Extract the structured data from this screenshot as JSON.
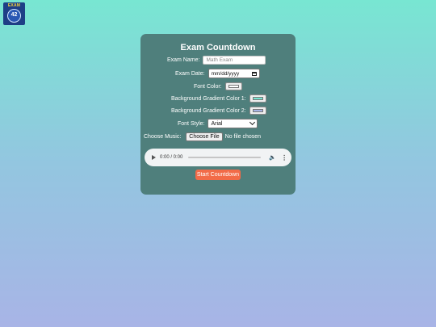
{
  "logo": {
    "text": "EXAM",
    "number": "42"
  },
  "form": {
    "title": "Exam Countdown",
    "exam_name_label": "Exam Name:",
    "exam_name_placeholder": "Math Exam",
    "exam_date_label": "Exam Date:",
    "exam_date_value": "mm/dd/yyyy",
    "font_color_label": "Font Color:",
    "font_color_value": "#ffffff",
    "bg_color1_label": "Background Gradient Color 1:",
    "bg_color1_value": "#78e6d2",
    "bg_color2_label": "Background Gradient Color 2:",
    "bg_color2_value": "#a8b4e6",
    "font_style_label": "Font Style:",
    "font_style_value": "Arial",
    "music_label": "Choose Music:",
    "choose_file_button": "Choose File",
    "no_file_text": "No file chosen",
    "audio_time": "0:00 / 0:00",
    "start_button": "Start Countdown"
  }
}
